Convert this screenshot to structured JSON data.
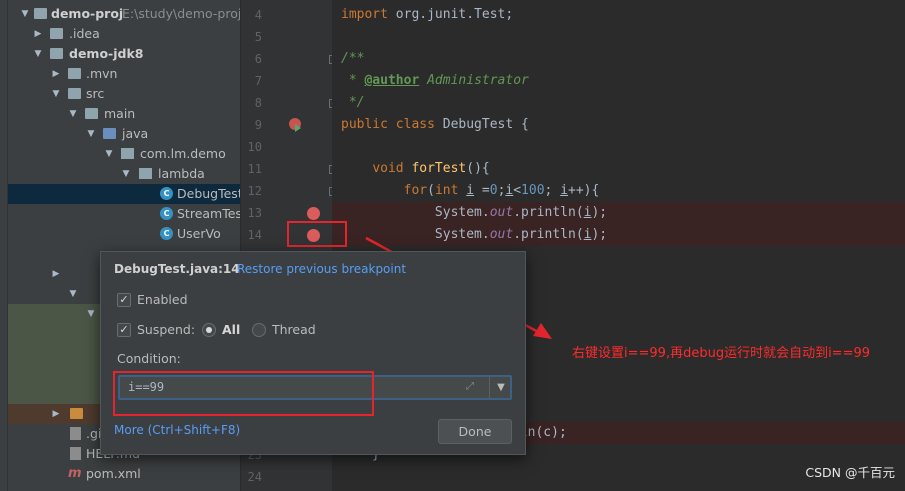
{
  "project_tree": {
    "rows": [
      {
        "label": "demo-proj",
        "path": "E:\\study\\demo-proj",
        "arrow": "▼",
        "icon": "folder",
        "bold": true,
        "indent": 0
      },
      {
        "label": ".idea",
        "arrow": "▶",
        "icon": "folder",
        "indent": 1
      },
      {
        "label": "demo-jdk8",
        "arrow": "▼",
        "icon": "folder",
        "bold": true,
        "indent": 1
      },
      {
        "label": ".mvn",
        "arrow": "▶",
        "icon": "folder",
        "indent": 2
      },
      {
        "label": "src",
        "arrow": "▼",
        "icon": "folder",
        "indent": 2
      },
      {
        "label": "main",
        "arrow": "▼",
        "icon": "folder",
        "indent": 3
      },
      {
        "label": "java",
        "arrow": "▼",
        "icon": "folder-blue",
        "indent": 4
      },
      {
        "label": "com.lm.demo",
        "arrow": "▼",
        "icon": "package",
        "indent": 5
      },
      {
        "label": "lambda",
        "arrow": "▼",
        "icon": "package",
        "indent": 6
      },
      {
        "label": "DebugTest",
        "icon": "class",
        "indent": 7,
        "selected": true
      },
      {
        "label": "StreamTest",
        "icon": "class",
        "indent": 7
      },
      {
        "label": "UserVo",
        "icon": "class",
        "indent": 7
      },
      {
        "label": ".gi",
        "icon": "file",
        "indent": 2
      },
      {
        "label": "HELP.md",
        "icon": "file",
        "indent": 2
      },
      {
        "label": "pom.xml",
        "icon": "maven",
        "indent": 2
      }
    ]
  },
  "gutter": {
    "line_numbers": [
      "4",
      "5",
      "6",
      "7",
      "8",
      "9",
      "10",
      "11",
      "12",
      "13",
      "14",
      "",
      "",
      "",
      "",
      "",
      "",
      "",
      "",
      "",
      "",
      "23",
      "24"
    ]
  },
  "editor": {
    "lines": [
      "import org.junit.Test;",
      "",
      "/**",
      " * @author Administrator",
      " */",
      "public class DebugTest {",
      "",
      "    void forTest(){",
      "        for(int i =0;i<100; i++){",
      "            System.out.println(i);",
      "            System.out.println(i);"
    ],
    "tail_1": ");",
    "tail_2": "tln(c);",
    "tail_3": "}"
  },
  "breakpoint_popup": {
    "title": "DebugTest.java:14",
    "restore_link": "Restore previous breakpoint",
    "enabled_label": "Enabled",
    "suspend_label": "Suspend:",
    "all_label": "All",
    "thread_label": "Thread",
    "condition_label": "Condition:",
    "condition_value": "i==99",
    "more_link": "More (Ctrl+Shift+F8)",
    "done_label": "Done",
    "enabled_checked": true,
    "suspend_checked": true,
    "suspend_mode": "All"
  },
  "annotation": {
    "text": "右键设置i==99,再debug运行时就会自动到i==99",
    "color": "#ff2b2b"
  },
  "watermark": "CSDN @千百元",
  "colors": {
    "breakpoint": "#db5c5c",
    "link": "#589df6",
    "selection": "#0d293e"
  }
}
